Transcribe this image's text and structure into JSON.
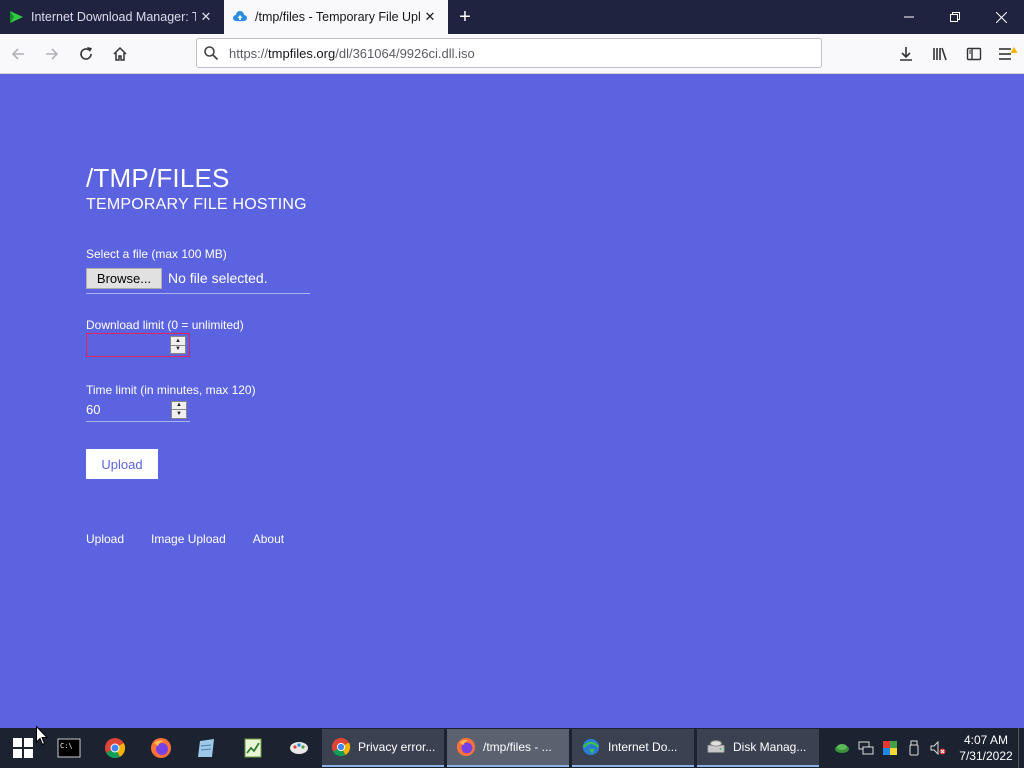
{
  "browser": {
    "tabs": [
      {
        "title": "Internet Download Manager: Th",
        "state": "inactive"
      },
      {
        "title": "/tmp/files - Temporary File Upl",
        "state": "active"
      }
    ],
    "url": {
      "prefix": "https://",
      "host": "tmpfiles.org",
      "path": "/dl/361064/9926ci.dll.iso"
    }
  },
  "page": {
    "title": "/TMP/FILES",
    "subtitle": "TEMPORARY FILE HOSTING",
    "file_label": "Select a file (max 100 MB)",
    "browse_label": "Browse...",
    "file_status": "No file selected.",
    "download_limit_label": "Download limit (0 = unlimited)",
    "download_limit_value": "",
    "time_limit_label": "Time limit (in minutes, max 120)",
    "time_limit_value": "60",
    "upload_label": "Upload",
    "footer": {
      "upload": "Upload",
      "image_upload": "Image Upload",
      "about": "About"
    }
  },
  "taskbar": {
    "apps": [
      {
        "label": "Privacy error...",
        "icon": "chrome-icon"
      },
      {
        "label": "/tmp/files - ...",
        "icon": "firefox-icon"
      },
      {
        "label": "Internet Do...",
        "icon": "idm-icon"
      },
      {
        "label": "Disk Manag...",
        "icon": "disk-management-icon"
      }
    ],
    "clock": {
      "time": "4:07 AM",
      "date": "7/31/2022"
    }
  },
  "colors": {
    "page_bg": "#5b63e0",
    "tab_strip": "#202340",
    "taskbar": "#1b2230"
  }
}
